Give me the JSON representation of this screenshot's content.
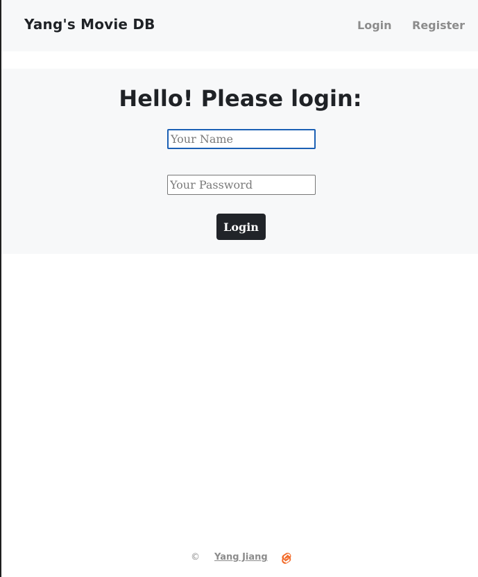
{
  "navbar": {
    "brand": "Yang's Movie DB",
    "links": {
      "login": "Login",
      "register": "Register"
    }
  },
  "login_form": {
    "heading": "Hello! Please login:",
    "name_field": {
      "placeholder": "Your Name",
      "value": ""
    },
    "password_field": {
      "placeholder": "Your Password",
      "value": ""
    },
    "submit_label": "Login"
  },
  "footer": {
    "copyright_symbol": "©",
    "author": "Yang Jiang",
    "logo_icon": "svelte-logo-icon"
  },
  "colors": {
    "navbar_background": "#f7f8f9",
    "panel_background": "#f7f8f9",
    "text_dark": "#1f2226",
    "nav_link": "#8c8c8c",
    "button_background": "#212429",
    "focus_ring": "#1a5fb4",
    "logo_orange": "#f26b2a"
  }
}
